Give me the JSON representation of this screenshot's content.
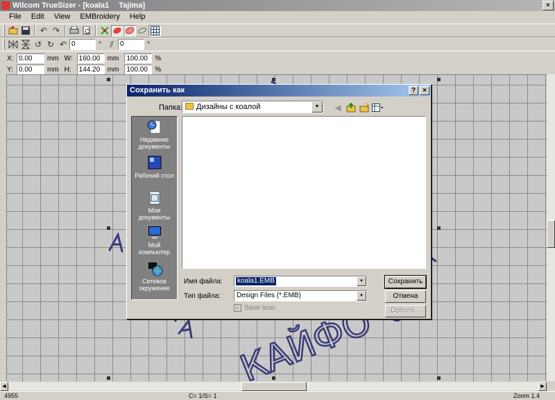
{
  "app": {
    "title": "Wilcom TrueSizer - [koala1",
    "document_format": "Tajima]"
  },
  "menu": [
    "File",
    "Edit",
    "View",
    "EMBroidery",
    "Help"
  ],
  "toolbar2": {
    "rotate_value": "0",
    "slant_value": "0",
    "degree_symbol": "°"
  },
  "coords": {
    "x_label": "X:",
    "x_value": "0.00",
    "y_label": "Y:",
    "y_value": "0.00",
    "w_label": "W:",
    "w_value": "160.00",
    "h_label": "H:",
    "h_value": "144.20",
    "unit": "mm",
    "w_scale": "100.00",
    "h_scale": "100.00",
    "pct": "%"
  },
  "dialog": {
    "title": "Сохранить как",
    "help_btn": "?",
    "close_btn": "×",
    "lookin_label": "Папка:",
    "lookin_value": "Дизайны с коалой",
    "places": [
      {
        "label": "Недавние документы"
      },
      {
        "label": "Рабочий стол"
      },
      {
        "label": "Мои документы"
      },
      {
        "label": "Мой компьютер"
      },
      {
        "label": "Сетевое окружение"
      }
    ],
    "filename_label": "Имя файла:",
    "filename_value": "koala1.EMB",
    "filetype_label": "Тип файла:",
    "filetype_value": "Design Files (*.EMB)",
    "save_icon_label": "Save Icon",
    "save_btn": "Сохранить",
    "cancel_btn": "Отмена",
    "options_btn": "Options..."
  },
  "design_text": "КАЙФО",
  "status": {
    "stitches": "4955",
    "colors": "C= 1/S= 1",
    "zoom": "Zoom 1.4"
  },
  "colors": {
    "dialog_title_start": "#0a246a",
    "dialog_title_end": "#a6caf0",
    "thread": "#3a3a78"
  }
}
